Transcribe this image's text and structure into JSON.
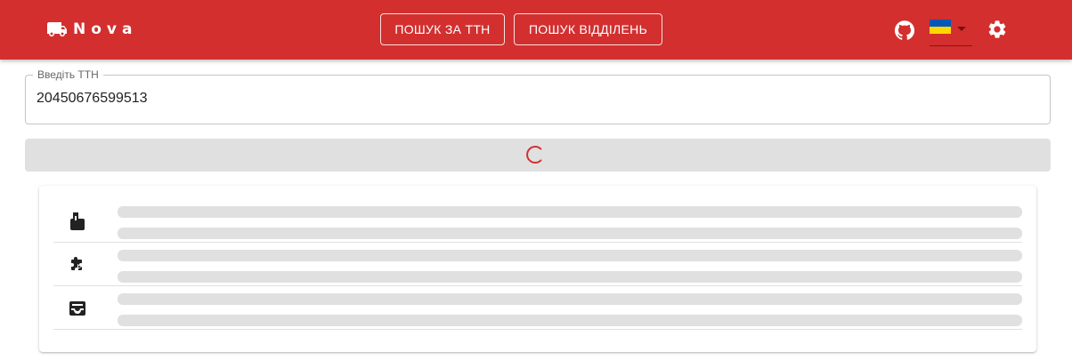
{
  "app": {
    "brand": "Nova",
    "brand_icon": "truck-icon"
  },
  "nav": {
    "ttn_search": "ПОШУК ЗА ТТН",
    "branch_search": "ПОШУК ВІДДІЛЕНЬ"
  },
  "header_icons": {
    "github": "github-icon",
    "language": "ukraine-flag",
    "settings": "settings-icon"
  },
  "colors": {
    "primary": "#d32f2f",
    "skeleton": "#e0e0e0",
    "flag_blue": "#0057b7",
    "flag_yellow": "#ffd700"
  },
  "search": {
    "label": "Введіть ТТН",
    "value": "20450676599513"
  },
  "loading": {
    "state": "loading",
    "spinner_color": "#d32f2f"
  },
  "details": {
    "rows": [
      {
        "icon": "parcel-icon"
      },
      {
        "icon": "extension-play-icon"
      },
      {
        "icon": "inbox-tray-icon"
      }
    ]
  }
}
